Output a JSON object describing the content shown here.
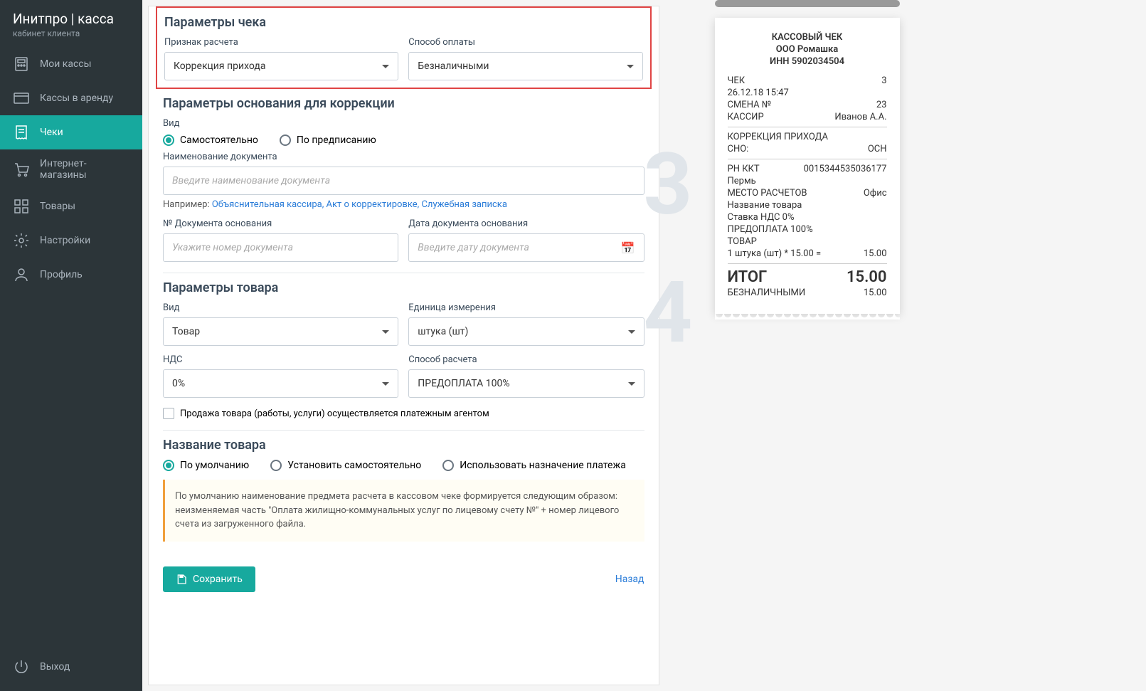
{
  "logo": {
    "title": "Инитпро | касса",
    "subtitle": "кабинет клиента"
  },
  "nav": {
    "items": [
      {
        "label": "Мои кассы"
      },
      {
        "label": "Кассы в аренду"
      },
      {
        "label": "Чеки"
      },
      {
        "label": "Интернет-магазины"
      },
      {
        "label": "Товары"
      },
      {
        "label": "Настройки"
      },
      {
        "label": "Профиль"
      }
    ],
    "exit": "Выход"
  },
  "s1": {
    "title": "Параметры чека",
    "f1_label": "Признак расчета",
    "f1_value": "Коррекция прихода",
    "f2_label": "Способ оплаты",
    "f2_value": "Безналичными"
  },
  "s2": {
    "title": "Параметры основания для коррекции",
    "vid_label": "Вид",
    "r1": "Самостоятельно",
    "r2": "По предписанию",
    "docname_label": "Наименование документа",
    "docname_ph": "Введите наименование документа",
    "hint_prefix": "Например: ",
    "hint_links": "Объяснительная кассира,  Акт о корректировке,  Служебная записка",
    "docnum_label": "№ Документа основания",
    "docnum_ph": "Укажите номер документа",
    "docdate_label": "Дата документа основания",
    "docdate_ph": "Введите дату документа"
  },
  "s3": {
    "title": "Параметры товара",
    "vid_label": "Вид",
    "vid_value": "Товар",
    "unit_label": "Единица измерения",
    "unit_value": "штука (шт)",
    "nds_label": "НДС",
    "nds_value": "0%",
    "method_label": "Способ расчета",
    "method_value": "ПРЕДОПЛАТА 100%",
    "agent_check": "Продажа товара (работы, услуги) осуществляется платежным агентом"
  },
  "s4": {
    "title": "Название товара",
    "r1": "По умолчанию",
    "r2": "Установить самостоятельно",
    "r3": "Использовать назначение платежа",
    "info": "По умолчанию наименование предмета расчета в кассовом чеке формируется следующим образом: неизменяемая часть \"Оплата жилищно-коммунальных услуг по лицевому счету №\" + номер лицевого счета из загруженного файла."
  },
  "footer": {
    "save": "Сохранить",
    "back": "Назад"
  },
  "receipt": {
    "h1": "КАССОВЫЙ ЧЕК",
    "h2": "ООО Ромашка",
    "h3": "ИНН 5902034504",
    "l1a": "ЧЕК",
    "l1b": "3",
    "l2": "26.12.18 15:47",
    "l3a": "СМЕНА №",
    "l3b": "23",
    "l4a": "КАССИР",
    "l4b": "Иванов А.А.",
    "l5": "КОРРЕКЦИЯ ПРИХОДА",
    "l6a": "СНО:",
    "l6b": "ОСН",
    "l7a": "РН ККТ",
    "l7b": "0015344535036177",
    "l8": "Пермь",
    "l9a": "МЕСТО РАСЧЕТОВ",
    "l9b": "Офис",
    "l10": "Название товара",
    "l11": "Ставка НДС 0%",
    "l12": "ПРЕДОПЛАТА 100%",
    "l13": "ТОВАР",
    "l14a": "1 штука (шт) * 15.00 =",
    "l14b": "15.00",
    "tot_a": "ИТОГ",
    "tot_b": "15.00",
    "l15a": "БЕЗНАЛИЧНЫМИ",
    "l15b": "15.00"
  }
}
